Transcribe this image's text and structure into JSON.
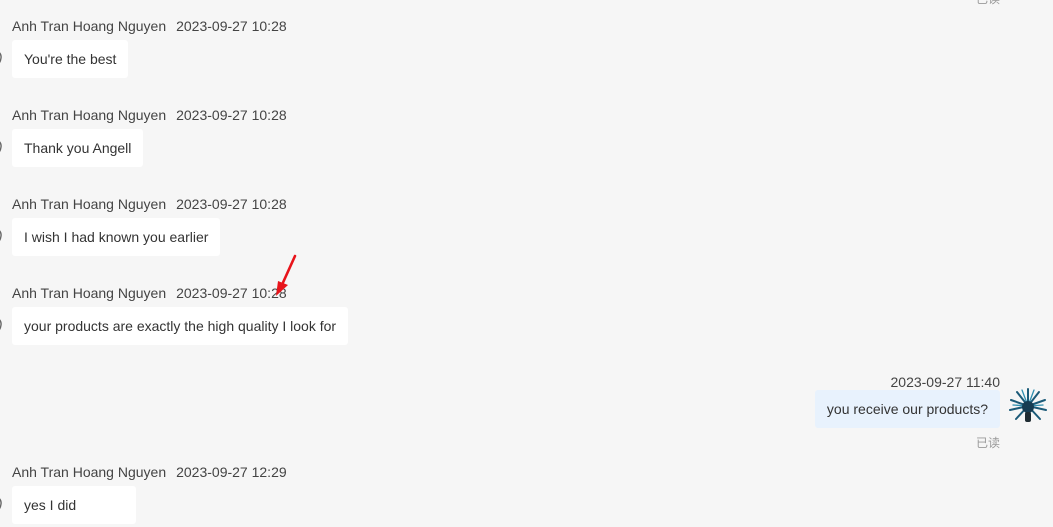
{
  "read_label": "已读",
  "accent_color": "#e8f2fd",
  "incoming": [
    {
      "sender": "Anh Tran Hoang Nguyen",
      "time": "2023-09-27 10:28",
      "text": "You're the best"
    },
    {
      "sender": "Anh Tran Hoang Nguyen",
      "time": "2023-09-27 10:28",
      "text": "Thank you Angell"
    },
    {
      "sender": "Anh Tran Hoang Nguyen",
      "time": "2023-09-27 10:28",
      "text": "I wish I had known you earlier"
    },
    {
      "sender": "Anh Tran Hoang Nguyen",
      "time": "2023-09-27 10:28",
      "text": "your products are exactly the high quality I look for"
    },
    {
      "sender": "Anh Tran Hoang Nguyen",
      "time": "2023-09-27 12:29",
      "text": "yes I did"
    }
  ],
  "outgoing": {
    "time": "2023-09-27 11:40",
    "text": "you receive our products?",
    "status": "已读"
  }
}
